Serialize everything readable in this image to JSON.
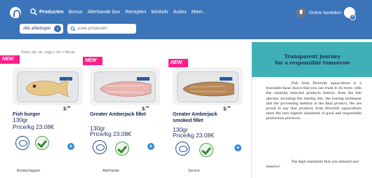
{
  "nav": {
    "items": [
      "Producten",
      "Bonus",
      "Allerhande box",
      "Recepten",
      "Winkels",
      "Acties",
      "Meer..."
    ],
    "order_label": "Online bestellen",
    "cart_count": "0"
  },
  "subbar": {
    "department_label": "Alle afdelingen",
    "search_placeholder": "Zoek producten"
  },
  "breadcrumb": "Vlees, kip, vis, vega > Vis > Nieuw",
  "products": [
    {
      "badge": "NEW",
      "title": "Fish burger",
      "weight": "130gr",
      "price_per_kg": "Price/kg 23.08€",
      "price_main": "3.",
      "price_cents": "99"
    },
    {
      "badge": "NEW",
      "title": "Greater Amberjack fillet",
      "weight": "130gr",
      "price_per_kg": "Price/kg 23.08€",
      "price_main": "3.",
      "price_cents": "99"
    },
    {
      "badge": "NEW",
      "title": "Greater Amberjack smoked fillet",
      "weight": "130gr",
      "price_per_kg": "Price/kg 23.08€",
      "price_main": "3.",
      "price_cents": "99"
    }
  ],
  "footer": [
    "Boodschappen",
    "Allerhande",
    "Service"
  ],
  "overlay": {
    "title_line1": "Transparent journey",
    "title_line2": "for a responsible tomorrow",
    "paragraph1": "Fish from Diversify aquaculture is a traceable meal choice that you can track to its roots, with the carefully selected products history: from the fish species, including the rearing site, the rearing technique and the processing method of the final product. We are proud to say that products from Diversify aquaculture meet the very highest standards of good and responsible production practices.",
    "paragraph2": "The high standards that you demand and deserve!"
  },
  "colors": {
    "nav_blue": "#3b74b8",
    "badge_pink": "#ff1e8c",
    "overlay_teal": "#3fb0b5"
  }
}
